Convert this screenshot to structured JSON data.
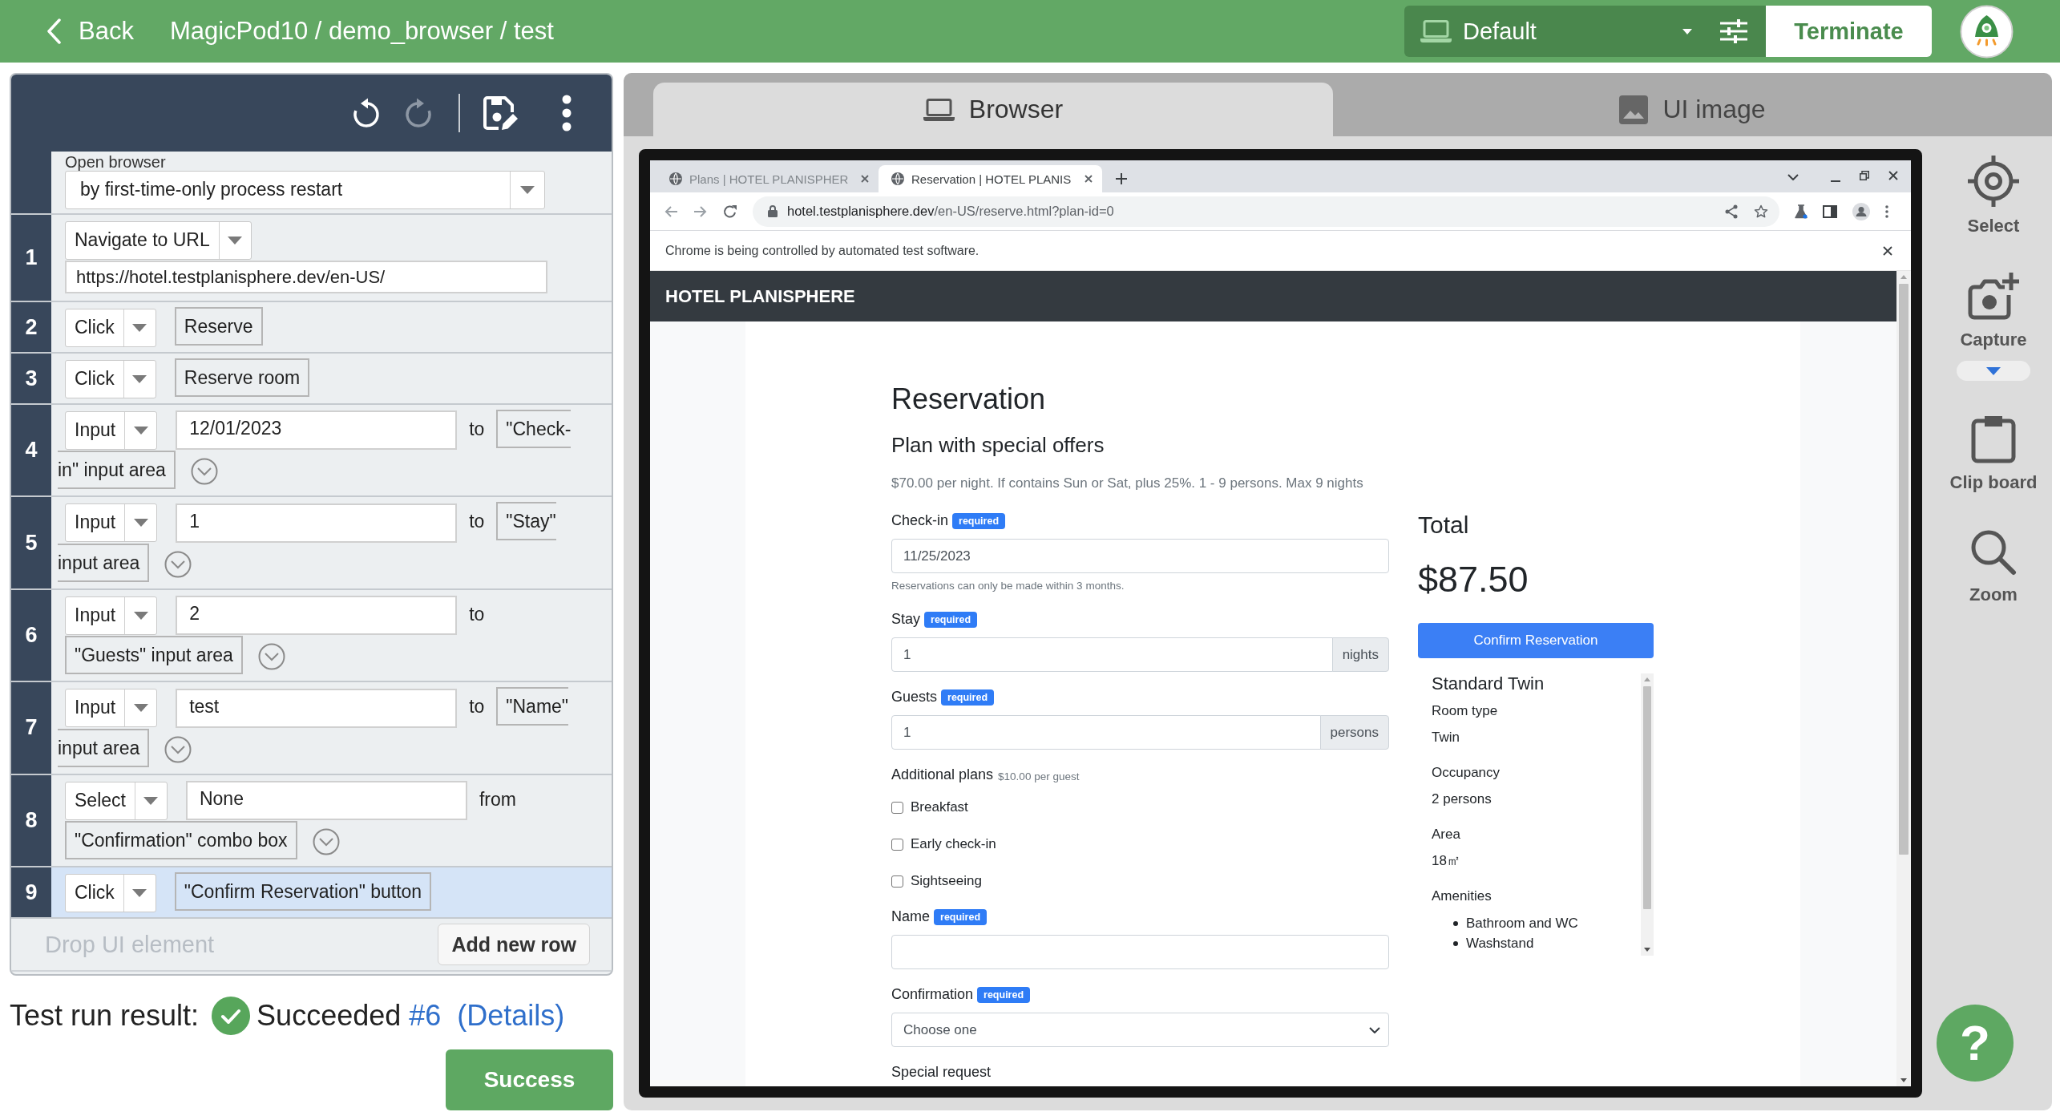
{
  "top_bar": {
    "back": "Back",
    "title": "MagicPod10 / demo_browser / test",
    "device": "Default",
    "terminate": "Terminate"
  },
  "editor": {
    "toolbar": [
      {
        "kind": "undo",
        "disabled": false
      },
      {
        "kind": "redo",
        "disabled": true
      },
      {
        "kind": "save",
        "disabled": false
      },
      {
        "kind": "more",
        "disabled": false
      }
    ],
    "steps": [
      {
        "kind": "option",
        "label": "Open browser",
        "option": "by first-time-only process restart",
        "selected": false
      },
      {
        "kind": "url",
        "number": "1",
        "action": "Navigate to URL",
        "value": "https://hotel.testplanisphere.dev/en-US/",
        "selected": false
      },
      {
        "kind": "element",
        "number": "2",
        "action": "Click",
        "target": "Reserve",
        "selected": false
      },
      {
        "kind": "element",
        "number": "3",
        "action": "Click",
        "target": "Reserve room",
        "selected": false
      },
      {
        "kind": "value",
        "number": "4",
        "action": "Input",
        "value": "12/01/2023",
        "connector": "to",
        "target": "\"Check-in\" input area",
        "selected": false
      },
      {
        "kind": "value",
        "number": "5",
        "action": "Input",
        "value": "1",
        "connector": "to",
        "target": "\"Stay\" input area",
        "selected": false
      },
      {
        "kind": "value",
        "number": "6",
        "action": "Input",
        "value": "2",
        "connector": "to",
        "target": "\"Guests\" input area",
        "selected": false
      },
      {
        "kind": "value",
        "number": "7",
        "action": "Input",
        "value": "test",
        "connector": "to",
        "target": "\"Name\" input area",
        "selected": false
      },
      {
        "kind": "value",
        "number": "8",
        "action": "Select",
        "value": "None",
        "connector": "from",
        "target": "\"Confirmation\" combo box",
        "selected": false
      },
      {
        "kind": "element",
        "number": "9",
        "action": "Click",
        "target": "\"Confirm Reservation\" button",
        "selected": true
      }
    ],
    "drop_hint": "Drop UI element",
    "add_row": "Add new row"
  },
  "result": {
    "label": "Test run result:",
    "status": "Succeeded",
    "run": "#6",
    "details": "(Details)"
  },
  "success_button": "Success",
  "viewer": {
    "tabs": [
      {
        "kind": "browser",
        "label": "Browser",
        "selected": true
      },
      {
        "kind": "image",
        "label": "UI image",
        "selected": false
      }
    ],
    "browser": {
      "tabs": [
        {
          "title": "Plans | HOTEL PLANISPHER",
          "selected": false
        },
        {
          "title": "Reservation | HOTEL PLANIS",
          "selected": true
        }
      ],
      "address": {
        "host": "hotel.testplanisphere.dev",
        "path": "/en-US/reserve.html?plan-id=0"
      },
      "infobar": "Chrome is being controlled by automated test software.",
      "page": {
        "brand": "HOTEL PLANISPHERE",
        "heading": "Reservation",
        "plan": "Plan with special offers",
        "description": "$70.00 per night. If contains Sun or Sat, plus 25%. 1 - 9 persons. Max 9 nights",
        "fields": [
          {
            "kind": "text",
            "label": "Check-in",
            "badge": "required",
            "value": "11/25/2023",
            "hint": "Reservations can only be made within 3 months."
          },
          {
            "kind": "addon",
            "label": "Stay",
            "badge": "required",
            "value": "1",
            "addon": "nights"
          },
          {
            "kind": "addon",
            "label": "Guests",
            "badge": "required",
            "value": "1",
            "addon": "persons"
          },
          {
            "kind": "checks",
            "label": "Additional plans",
            "note": "$10.00 per guest",
            "options": [
              {
                "label": "Breakfast",
                "checked": false
              },
              {
                "label": "Early check-in",
                "checked": false
              },
              {
                "label": "Sightseeing",
                "checked": false
              }
            ]
          },
          {
            "kind": "text",
            "label": "Name",
            "badge": "required"
          },
          {
            "kind": "select",
            "label": "Confirmation",
            "badge": "required",
            "value": "Choose one"
          },
          {
            "kind": "label",
            "label": "Special request"
          }
        ],
        "total": {
          "label": "Total",
          "amount": "$87.50",
          "button": "Confirm Reservation"
        },
        "room": {
          "name": "Standard Twin",
          "details": [
            {
              "term": "Room type",
              "value": "Twin"
            },
            {
              "term": "Occupancy",
              "value": "2 persons"
            },
            {
              "term": "Area",
              "value": "18㎡"
            }
          ],
          "amenities": {
            "term": "Amenities",
            "items": [
              "Bathroom and WC",
              "Washstand"
            ]
          }
        }
      }
    },
    "tools": [
      {
        "kind": "target",
        "label": "Select",
        "has_menu": false
      },
      {
        "kind": "capture",
        "label": "Capture",
        "has_menu": true
      },
      {
        "kind": "clipboard",
        "label": "Clip board",
        "has_menu": false
      },
      {
        "kind": "zoom",
        "label": "Zoom",
        "has_menu": false
      }
    ],
    "help": "?"
  }
}
